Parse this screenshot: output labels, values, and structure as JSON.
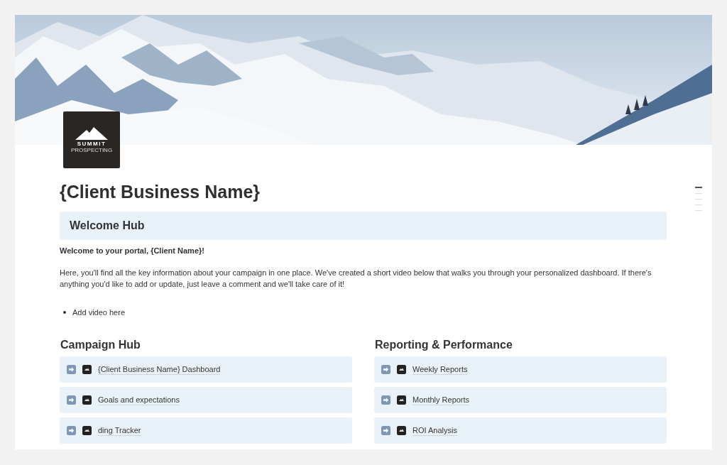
{
  "logo": {
    "name": "SUMMIT",
    "tagline": "PROSPECTING"
  },
  "title": "{Client Business Name}",
  "callout": {
    "heading": "Welcome Hub"
  },
  "intro": "Welcome to your portal, {Client Name}!",
  "paragraph": "Here, you'll find all the key information about your campaign in one place. We've created a short video below that walks you through your personalized dashboard. If there's anything you'd like to add or update, just leave a comment and we'll take care of it!",
  "bullets": [
    "Add video here"
  ],
  "columns": [
    {
      "heading": "Campaign Hub",
      "links": [
        "{Client Business Name} Dashboard",
        "Goals and expectations",
        "ding Tracker"
      ]
    },
    {
      "heading": "Reporting & Performance",
      "links": [
        "Weekly Reports",
        "Monthly Reports",
        "ROI Analysis"
      ]
    }
  ],
  "outline_marks": [
    {
      "selected": true
    },
    {
      "selected": false
    },
    {
      "selected": false
    },
    {
      "selected": false
    },
    {
      "selected": false
    }
  ]
}
